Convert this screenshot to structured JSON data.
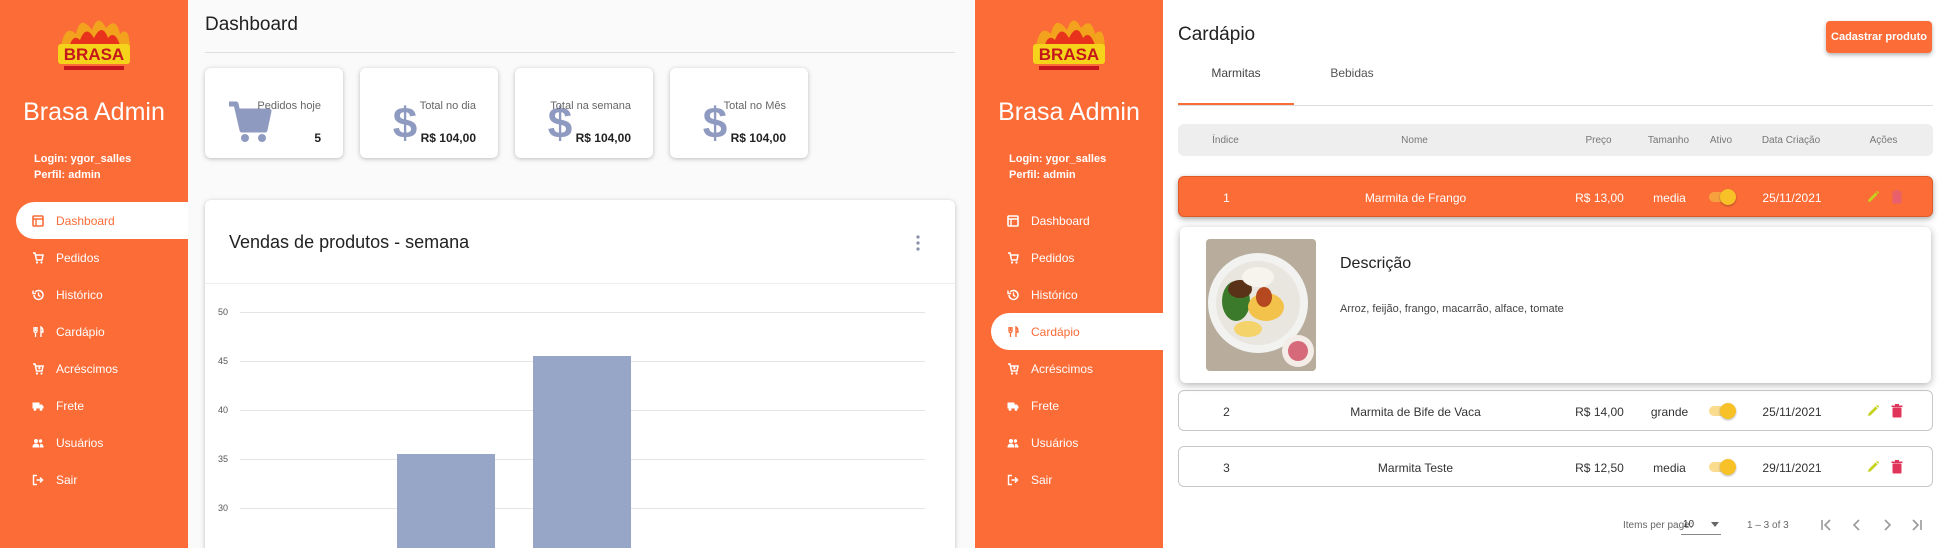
{
  "left": {
    "sidebar": {
      "brand_logo": "BRASA",
      "title": "Brasa Admin",
      "login": "Login: ygor_salles",
      "profile": "Perfil: admin",
      "items": [
        {
          "label": "Dashboard",
          "icon": "dashboard-icon",
          "active": true
        },
        {
          "label": "Pedidos",
          "icon": "cart-icon"
        },
        {
          "label": "Histórico",
          "icon": "history-icon"
        },
        {
          "label": "Cardápio",
          "icon": "cutlery-icon"
        },
        {
          "label": "Acréscimos",
          "icon": "cart-plus-icon"
        },
        {
          "label": "Frete",
          "icon": "truck-icon"
        },
        {
          "label": "Usuários",
          "icon": "users-icon"
        },
        {
          "label": "Sair",
          "icon": "logout-icon"
        }
      ]
    },
    "page_title": "Dashboard",
    "stats": [
      {
        "label": "Pedidos hoje",
        "value": "5",
        "icon": "cart-icon"
      },
      {
        "label": "Total no dia",
        "value": "R$ 104,00",
        "icon": "dollar-icon"
      },
      {
        "label": "Total na semana",
        "value": "R$ 104,00",
        "icon": "dollar-icon"
      },
      {
        "label": "Total no Mês",
        "value": "R$ 104,00",
        "icon": "dollar-icon"
      }
    ],
    "chart_card": {
      "title": "Vendas de produtos - semana"
    },
    "chart_data": {
      "type": "bar",
      "title": "Vendas de produtos - semana",
      "yticks": [
        "50",
        "45",
        "40",
        "35",
        "30"
      ],
      "ylim": [
        30,
        50
      ],
      "values": [
        35.5,
        45.5
      ],
      "grid": true,
      "color": "#97a5c7"
    }
  },
  "right": {
    "sidebar": {
      "brand_logo": "BRASA",
      "title": "Brasa Admin",
      "login": "Login: ygor_salles",
      "profile": "Perfil: admin",
      "items": [
        {
          "label": "Dashboard",
          "icon": "dashboard-icon"
        },
        {
          "label": "Pedidos",
          "icon": "cart-icon"
        },
        {
          "label": "Histórico",
          "icon": "history-icon"
        },
        {
          "label": "Cardápio",
          "icon": "cutlery-icon",
          "active": true
        },
        {
          "label": "Acréscimos",
          "icon": "cart-plus-icon"
        },
        {
          "label": "Frete",
          "icon": "truck-icon"
        },
        {
          "label": "Usuários",
          "icon": "users-icon"
        },
        {
          "label": "Sair",
          "icon": "logout-icon"
        }
      ]
    },
    "page_title": "Cardápio",
    "add_button": "Cadastrar produto",
    "tabs": [
      {
        "label": "Marmitas",
        "active": true
      },
      {
        "label": "Bebidas"
      }
    ],
    "table": {
      "headers": [
        "Índice",
        "Nome",
        "Preço",
        "Tamanho",
        "Ativo",
        "Data Criação",
        "Ações"
      ],
      "rows": [
        {
          "index": "1",
          "name": "Marmita de Frango",
          "price": "R$ 13,00",
          "size": "media",
          "active": true,
          "date": "25/11/2021",
          "selected": true
        },
        {
          "index": "2",
          "name": "Marmita de Bife de Vaca",
          "price": "R$ 14,00",
          "size": "grande",
          "active": true,
          "date": "25/11/2021"
        },
        {
          "index": "3",
          "name": "Marmita Teste",
          "price": "R$ 12,50",
          "size": "media",
          "active": true,
          "date": "29/11/2021"
        }
      ]
    },
    "detail": {
      "title": "Descrição",
      "text": "Arroz, feijão, frango, macarrão, alface, tomate"
    },
    "pagination": {
      "items_per_page_label": "Items per page:",
      "items_per_page": "10",
      "range": "1 – 3 of 3"
    },
    "colors": {
      "accent": "#fb6c37",
      "toggle": "#f8c128",
      "edit": "#c6d21e",
      "delete": "#e0355a"
    }
  }
}
